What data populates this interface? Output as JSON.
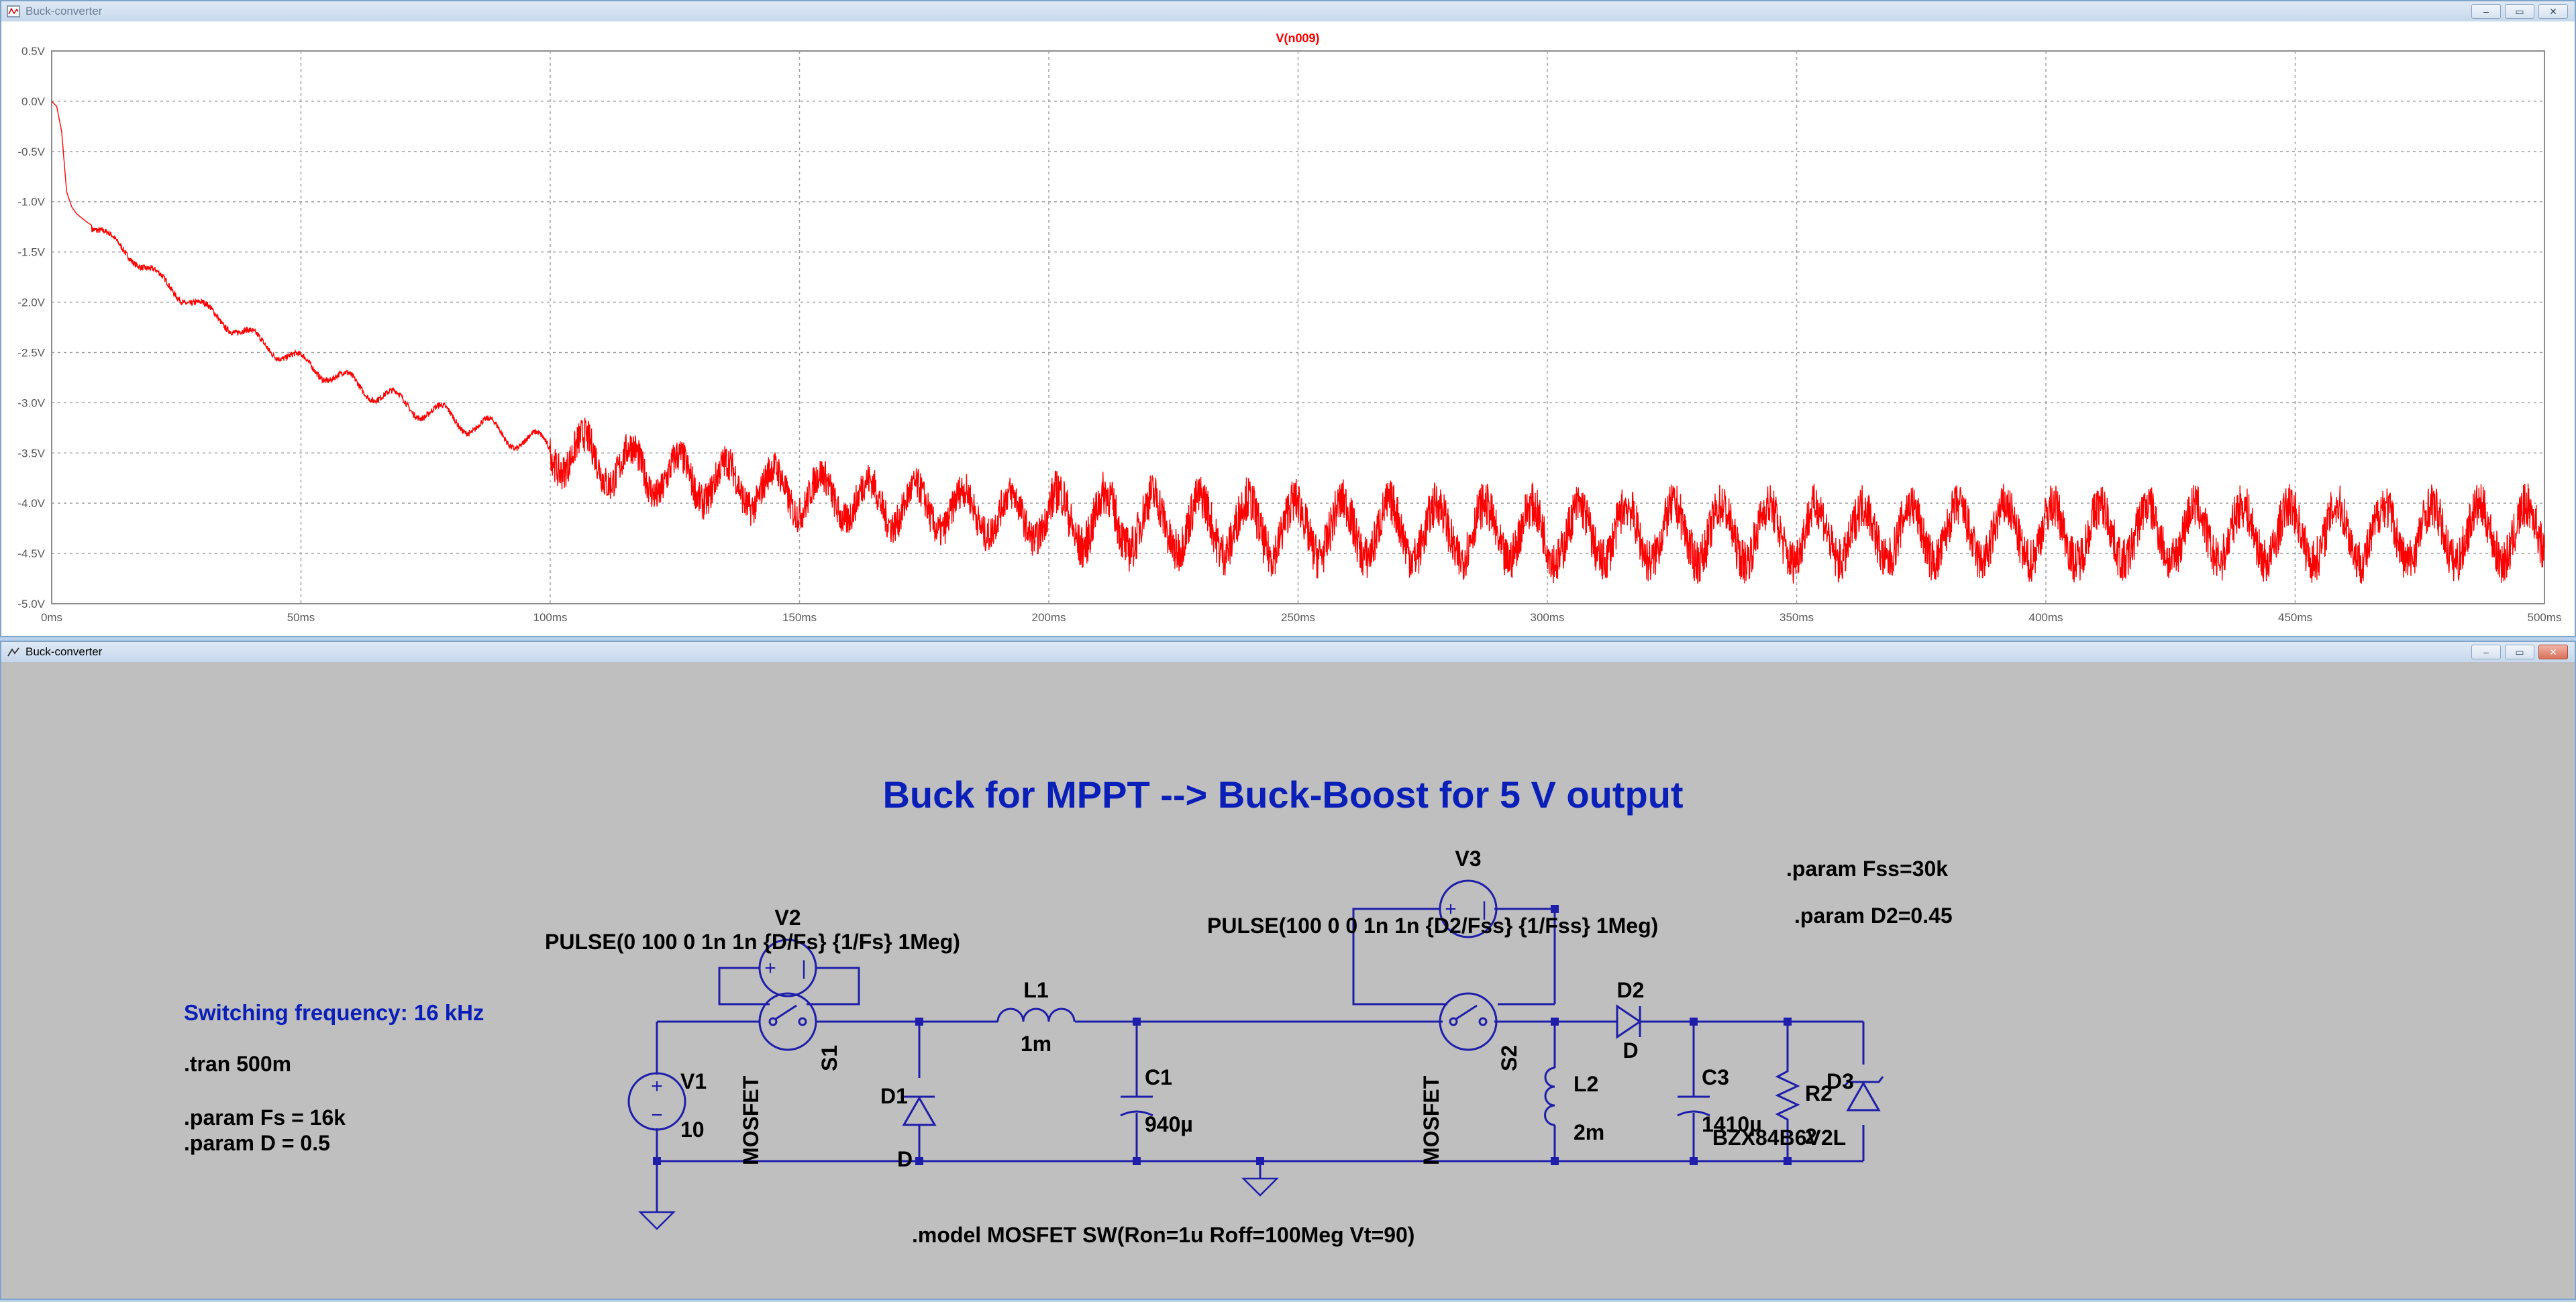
{
  "plot_window": {
    "title": "Buck-converter",
    "trace_name": "V(n009)",
    "buttons": {
      "minimize": "–",
      "restore": "▭",
      "close": "✕"
    }
  },
  "schematic_window": {
    "title": "Buck-converter",
    "buttons": {
      "minimize": "–",
      "restore": "▭",
      "close": "✕"
    }
  },
  "chart_data": {
    "type": "line",
    "title": "V(n009)",
    "xlabel": "",
    "ylabel": "",
    "x_unit": "ms",
    "xlim": [
      0,
      500
    ],
    "ylim": [
      -5.0,
      0.5
    ],
    "x_ticks": [
      "0ms",
      "50ms",
      "100ms",
      "150ms",
      "200ms",
      "250ms",
      "300ms",
      "350ms",
      "400ms",
      "450ms",
      "500ms"
    ],
    "y_ticks": [
      "0.5V",
      "0.0V",
      "-0.5V",
      "-1.0V",
      "-1.5V",
      "-2.0V",
      "-2.5V",
      "-3.0V",
      "-3.5V",
      "-4.0V",
      "-4.5V",
      "-5.0V"
    ],
    "grid": true,
    "series": [
      {
        "name": "V(n009)",
        "color": "#ff0000",
        "x": [
          0,
          1,
          2,
          3,
          4,
          5,
          7,
          10,
          15,
          20,
          25,
          30,
          40,
          50,
          60,
          70,
          80,
          90,
          100,
          120,
          150,
          175,
          200,
          250,
          300,
          350,
          400,
          450,
          500
        ],
        "y": [
          0.0,
          -0.05,
          -0.3,
          -0.9,
          -1.05,
          -1.12,
          -1.2,
          -1.3,
          -1.5,
          -1.7,
          -1.9,
          -2.05,
          -2.35,
          -2.6,
          -2.8,
          -3.0,
          -3.15,
          -3.3,
          -3.45,
          -3.7,
          -3.9,
          -4.05,
          -4.15,
          -4.25,
          -4.3,
          -4.3,
          -4.3,
          -4.3,
          -4.3
        ]
      }
    ]
  },
  "schematic": {
    "heading": "Buck for MPPT --> Buck-Boost for 5 V output",
    "switching_note": "Switching frequency: 16 kHz",
    "directives": {
      "tran": ".tran 500m",
      "param_fs": ".param Fs = 16k",
      "param_d": ".param D = 0.5",
      "param_fss": ".param Fss=30k",
      "param_d2": ".param D2=0.45",
      "model": ".model MOSFET SW(Ron=1u Roff=100Meg Vt=90)"
    },
    "components": {
      "v1_name": "V1",
      "v1_value": "10",
      "v2_name": "V2",
      "v2_value": "PULSE(0 100 0 1n 1n {D/Fs} {1/Fs} 1Meg)",
      "v3_name": "V3",
      "v3_value": "PULSE(100 0 0 1n 1n {D2/Fss} {1/Fss} 1Meg)",
      "s1_name": "S1",
      "s1_model": "MOSFET",
      "s2_name": "S2",
      "s2_model": "MOSFET",
      "d1_name": "D1",
      "d1_model": "D",
      "d2_name": "D2",
      "d2_model": "D",
      "d3_name": "D3",
      "d3_model": "BZX84B6V2L",
      "l1_name": "L1",
      "l1_value": "1m",
      "l2_name": "L2",
      "l2_value": "2m",
      "c1_name": "C1",
      "c1_value": "940µ",
      "c3_name": "C3",
      "c3_value": "1410µ",
      "r2_name": "R2",
      "r2_value": "2"
    }
  }
}
